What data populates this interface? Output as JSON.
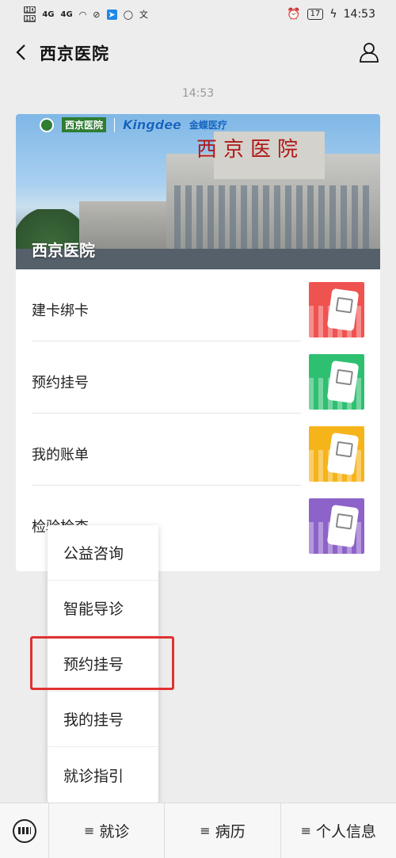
{
  "status_bar": {
    "signal_left": "4G",
    "signal_right": "4G",
    "battery": "17",
    "time": "14:53"
  },
  "header": {
    "title": "西京医院",
    "back_icon": "chevron-left-icon",
    "profile_icon": "person-icon"
  },
  "chat": {
    "timestamp": "14:53"
  },
  "card": {
    "logo_hospital": "西京医院",
    "logo_partner": "Kingdee",
    "logo_partner_suffix": "金蝶医疗",
    "roof_sign": "西京医院",
    "banner_caption": "西京医院",
    "items": [
      {
        "label": "建卡绑卡",
        "thumb_color": "#ef5350"
      },
      {
        "label": "预约挂号",
        "thumb_color": "#2fbf71"
      },
      {
        "label": "我的账单",
        "thumb_color": "#f6b41b"
      },
      {
        "label": "检验检查",
        "thumb_color": "#8e63c9"
      }
    ]
  },
  "popup_menu": {
    "items": [
      "公益咨询",
      "智能导诊",
      "预约挂号",
      "我的挂号",
      "就诊指引"
    ],
    "highlighted": "预约挂号"
  },
  "bottom_bar": {
    "keyboard_icon": "keyboard-icon",
    "tabs": [
      {
        "label": "就诊",
        "glyph": "≡"
      },
      {
        "label": "病历",
        "glyph": "≡"
      },
      {
        "label": "个人信息",
        "glyph": "≡"
      }
    ]
  }
}
